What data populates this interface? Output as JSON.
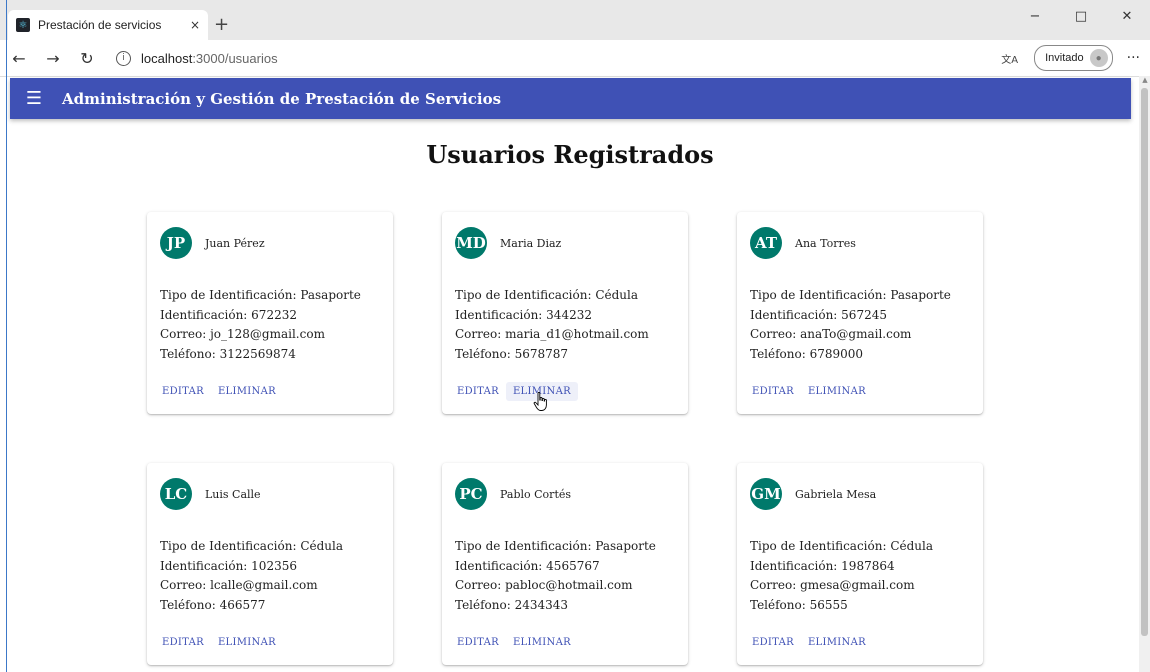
{
  "browser": {
    "tab_title": "Prestación de servicios",
    "tab_close": "×",
    "new_tab": "+",
    "minimize": "−",
    "maximize": "□",
    "close": "✕",
    "back": "←",
    "forward": "→",
    "reload": "↻",
    "url_host": "localhost",
    "url_path": ":3000/usuarios",
    "profile_label": "Invitado",
    "more": "···"
  },
  "appbar": {
    "title": "Administración y Gestión de Prestación de Servicios"
  },
  "page": {
    "title": "Usuarios Registrados"
  },
  "labels": {
    "id_type": "Tipo de Identificación: ",
    "id": "Identificación: ",
    "email": "Correo: ",
    "phone": "Teléfono: ",
    "edit": "EDITAR",
    "delete": "ELIMINAR"
  },
  "users": [
    {
      "initials": "JP",
      "name": "Juan Pérez",
      "id_type": "Pasaporte",
      "id": "672232",
      "email": "jo_128@gmail.com",
      "phone": "3122569874"
    },
    {
      "initials": "MD",
      "name": "Maria Diaz",
      "id_type": "Cédula",
      "id": "344232",
      "email": "maria_d1@hotmail.com",
      "phone": "5678787"
    },
    {
      "initials": "AT",
      "name": "Ana Torres",
      "id_type": "Pasaporte",
      "id": "567245",
      "email": "anaTo@gmail.com",
      "phone": "6789000"
    },
    {
      "initials": "LC",
      "name": "Luis Calle",
      "id_type": "Cédula",
      "id": "102356",
      "email": "lcalle@gmail.com",
      "phone": "466577"
    },
    {
      "initials": "PC",
      "name": "Pablo Cortés",
      "id_type": "Pasaporte",
      "id": "4565767",
      "email": "pabloc@hotmail.com",
      "phone": "2434343"
    },
    {
      "initials": "GM",
      "name": "Gabriela Mesa",
      "id_type": "Cédula",
      "id": "1987864",
      "email": "gmesa@gmail.com",
      "phone": "56555"
    }
  ],
  "colors": {
    "appbar": "#3f51b5",
    "avatar": "#00796b",
    "action": "#3f51b5"
  }
}
